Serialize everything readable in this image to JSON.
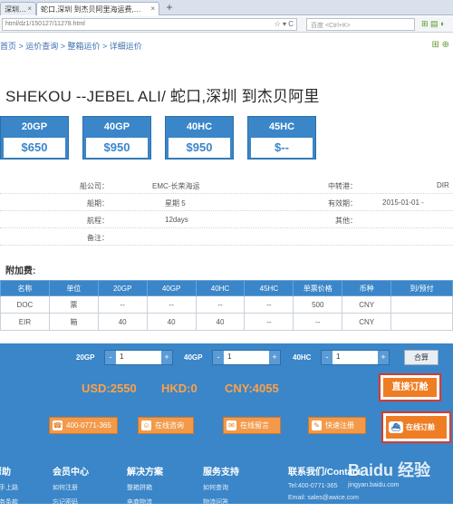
{
  "browser": {
    "tabs": [
      {
        "label": "深圳…",
        "active": false
      },
      {
        "label": "蛇口,深圳 到杰贝阿里海运费,…",
        "active": true
      }
    ],
    "new_tab": "+",
    "address": "html/dz1/150127/11278.html",
    "address_buttons": "☆ ▾ C",
    "search_placeholder": "百度 <Ctrl+K>"
  },
  "breadcrumb": "首页 > 运价查询 > 整箱运价 > 详细运价",
  "route_title": "SHEKOU --JEBEL ALI/ 蛇口,深圳 到杰贝阿里",
  "prices": [
    {
      "label": "20GP",
      "value": "$650"
    },
    {
      "label": "40GP",
      "value": "$950"
    },
    {
      "label": "40HC",
      "value": "$950"
    },
    {
      "label": "45HC",
      "value": "$--"
    }
  ],
  "info": {
    "carrier_label": "船公司：",
    "carrier": "EMC-长荣海运",
    "transfer_label": "中转港：",
    "transfer": "DIR",
    "schedule_label": "船期：",
    "schedule": "星期 5",
    "validity_label": "有效期：",
    "validity": "2015-01-01 -",
    "transit_label": "航程：",
    "transit": "12days",
    "other_label": "其他：",
    "other": "",
    "remarks_label": "备注：",
    "remarks": ""
  },
  "surcharge": {
    "title": "附加费:",
    "headers": [
      "名称",
      "单位",
      "20GP",
      "40GP",
      "40HC",
      "45HC",
      "单票价格",
      "币种",
      "到/预付"
    ],
    "rows": [
      [
        "DOC",
        "票",
        "--",
        "--",
        "--",
        "--",
        "500",
        "CNY",
        ""
      ],
      [
        "EIR",
        "箱",
        "40",
        "40",
        "40",
        "--",
        "--",
        "CNY",
        ""
      ]
    ]
  },
  "quantity": {
    "items": [
      {
        "label": "20GP",
        "value": "1"
      },
      {
        "label": "40GP",
        "value": "1"
      },
      {
        "label": "40HC",
        "value": "1"
      }
    ],
    "minus": "-",
    "plus": "+",
    "total_button": "合算"
  },
  "totals": {
    "usd": "USD:2550",
    "hkd": "HKD:0",
    "cny": "CNY:4055",
    "direct_order": "直接订舱"
  },
  "contact": {
    "phone": "400-0771-365",
    "consult": "在线咨询",
    "message": "在线留言",
    "register": "快速注册",
    "online_order": "在线订舱"
  },
  "footer": {
    "cols": [
      {
        "title": "帮助",
        "items": [
          "新手上路",
          "服务条款"
        ]
      },
      {
        "title": "会员中心",
        "items": [
          "如何注册",
          "忘记密码"
        ]
      },
      {
        "title": "解决方案",
        "items": [
          "整箱拼箱",
          "电商物流"
        ]
      },
      {
        "title": "服务支持",
        "items": [
          "如何查询",
          "物流问答"
        ]
      },
      {
        "title": "联系我们/Contact",
        "items": [
          "Tel:400-0771-365",
          "Email: sales@awice.com"
        ]
      }
    ],
    "watermark": "Baidu 经验",
    "watermark_sub": "jingyan.baidu.com"
  }
}
